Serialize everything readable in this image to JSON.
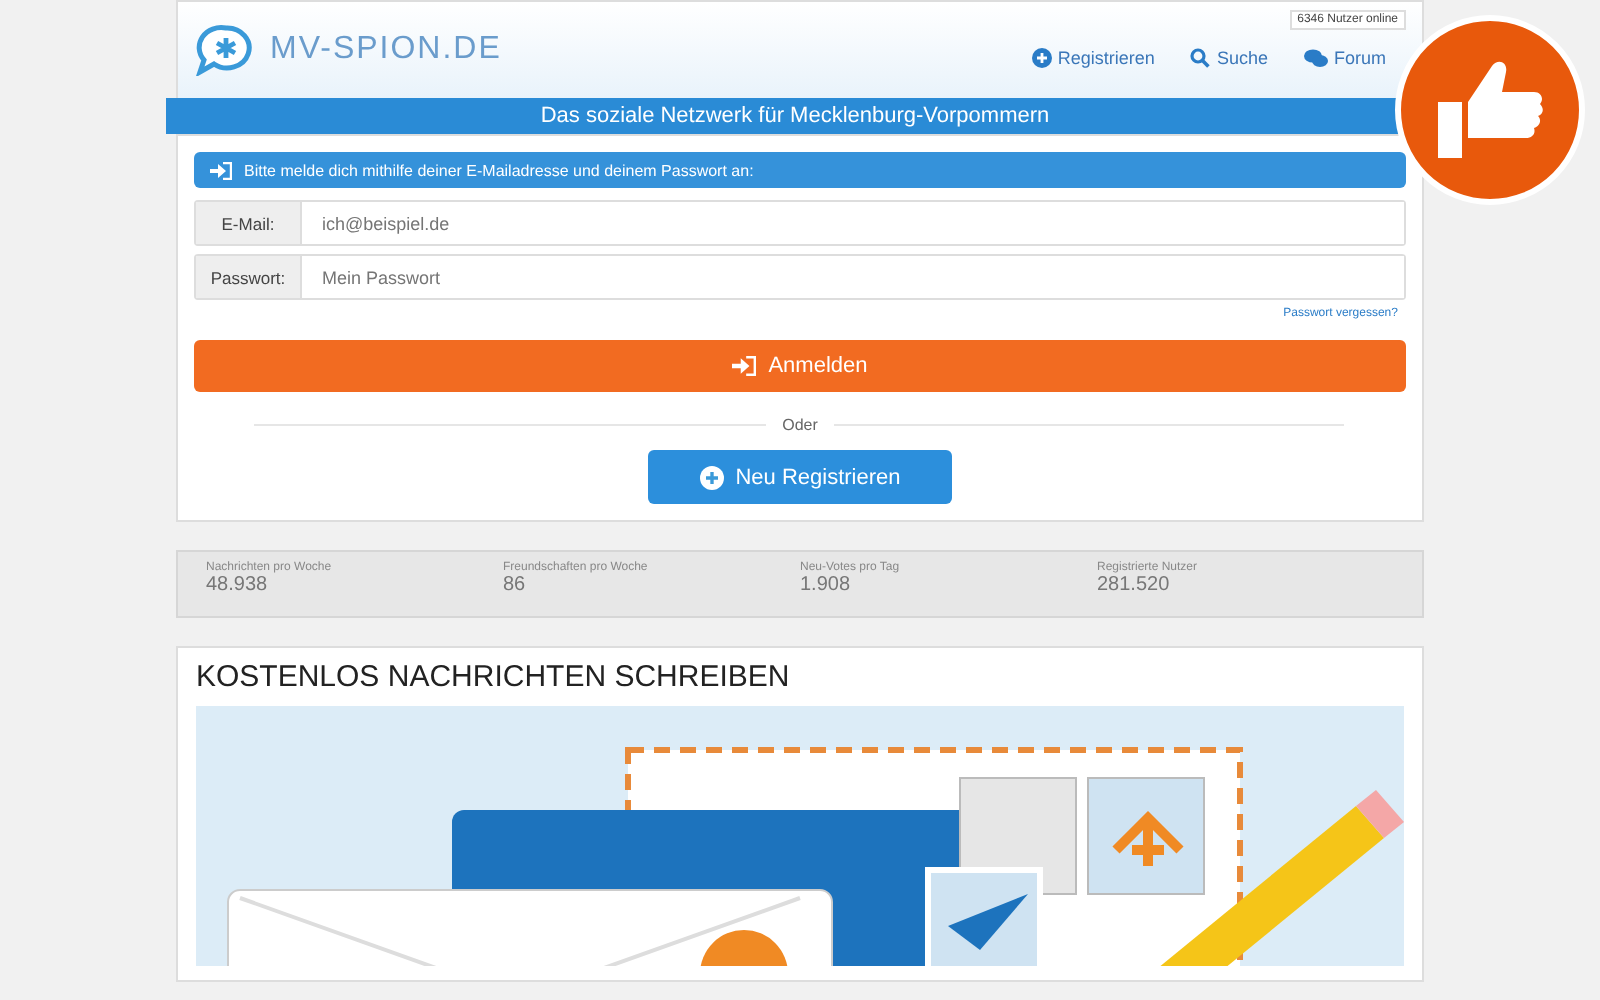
{
  "header": {
    "logo": "MV-SPION.DE",
    "online_badge": "6346 Nutzer online",
    "nav": [
      {
        "label": "Registrieren",
        "kind": "register"
      },
      {
        "label": "Suche",
        "kind": "search"
      },
      {
        "label": "Forum",
        "kind": "forum"
      }
    ]
  },
  "tagline": "Das soziale Netzwerk für Mecklenburg-Vorpommern",
  "login": {
    "notice": "Bitte melde dich mithilfe deiner E-Mailadresse und deinem Passwort an:",
    "fields": [
      {
        "label": "E-Mail:",
        "placeholder": "ich@beispiel.de"
      },
      {
        "label": "Passwort:",
        "placeholder": "Mein Passwort"
      }
    ],
    "forgot_link": "Passwort vergessen?",
    "submit": "Anmelden",
    "divider": "Oder",
    "register": "Neu Registrieren"
  },
  "stats": [
    {
      "label": "Nachrichten pro Woche",
      "value": "48.938"
    },
    {
      "label": "Freundschaften pro Woche",
      "value": "86"
    },
    {
      "label": "Neu-Votes pro Tag",
      "value": "1.908"
    },
    {
      "label": "Registrierte Nutzer",
      "value": "281.520"
    }
  ],
  "section": {
    "title": "KOSTENLOS NACHRICHTEN SCHREIBEN"
  }
}
